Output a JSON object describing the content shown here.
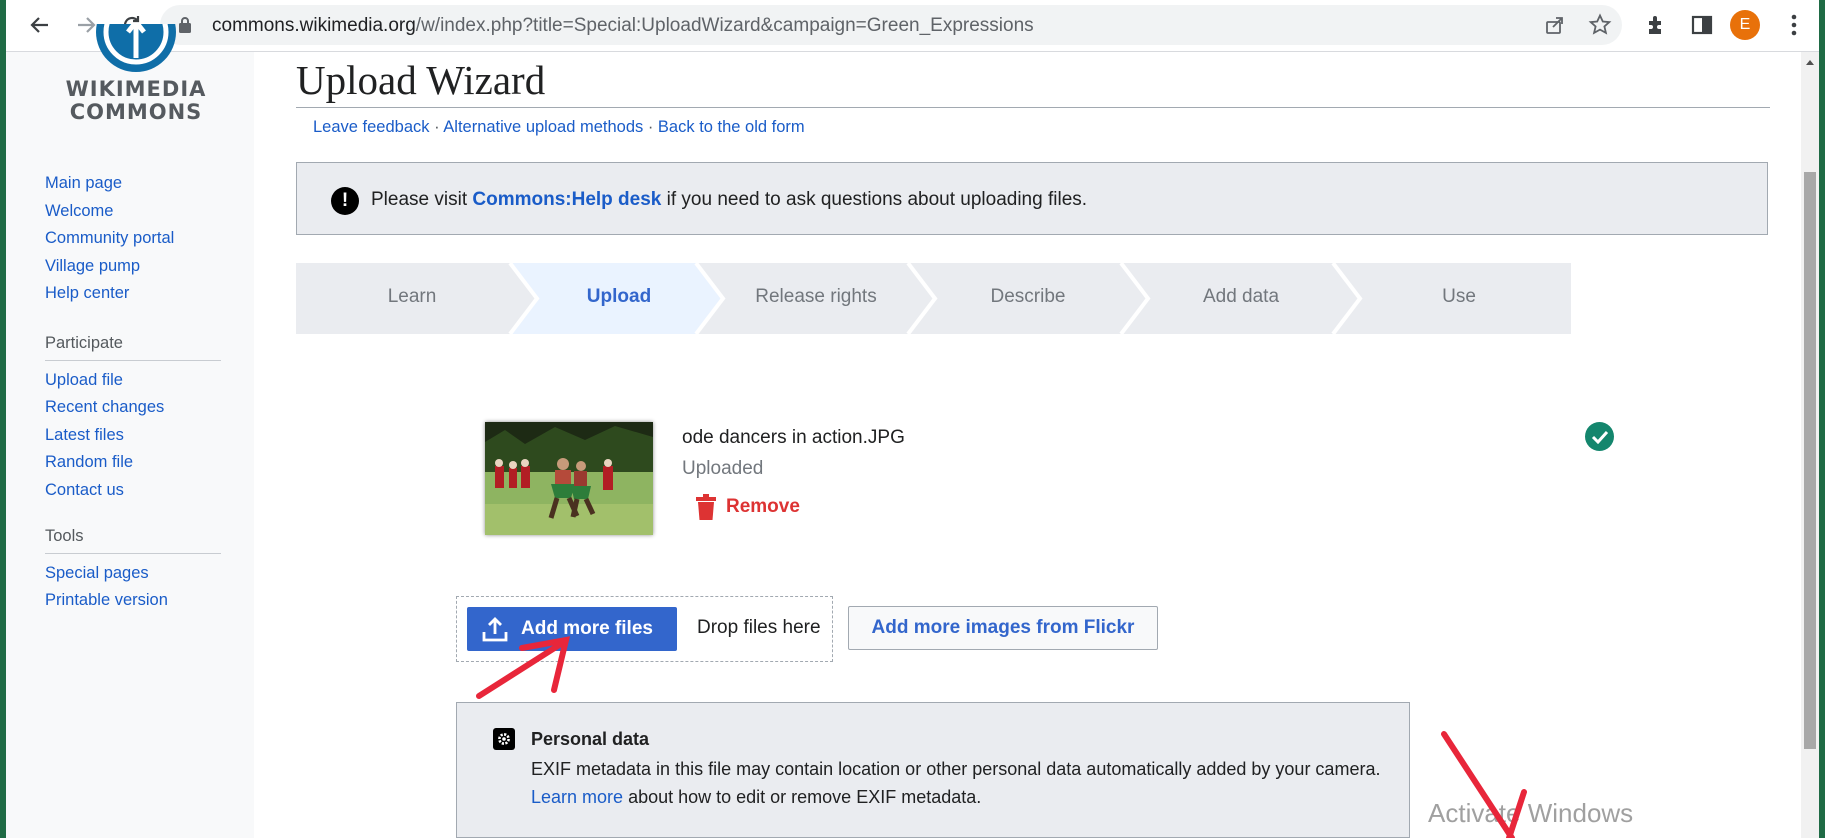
{
  "browser": {
    "url_host": "commons.wikimedia.org",
    "url_path": "/w/index.php?title=Special:UploadWizard&campaign=Green_Expressions",
    "profile_initial": "E",
    "profile_color": "#e8710a"
  },
  "sidebar": {
    "logo_line1": "WIKIMEDIA",
    "logo_line2": "COMMONS",
    "nav_main": [
      "Main page",
      "Welcome",
      "Community portal",
      "Village pump",
      "Help center"
    ],
    "participate_heading": "Participate",
    "nav_participate": [
      "Upload file",
      "Recent changes",
      "Latest files",
      "Random file",
      "Contact us"
    ],
    "tools_heading": "Tools",
    "nav_tools": [
      "Special pages",
      "Printable version"
    ]
  },
  "main": {
    "title": "Upload Wizard",
    "top_links": [
      "Leave feedback",
      "Alternative upload methods",
      "Back to the old form"
    ],
    "link_separator": " · ",
    "notice": {
      "icon": "!",
      "prefix": "Please visit ",
      "link": "Commons:Help desk",
      "suffix": " if you need to ask questions about uploading files."
    },
    "steps": [
      {
        "label": "Learn",
        "active": false
      },
      {
        "label": "Upload",
        "active": true
      },
      {
        "label": "Release rights",
        "active": false
      },
      {
        "label": "Describe",
        "active": false
      },
      {
        "label": "Add data",
        "active": false
      },
      {
        "label": "Use",
        "active": false
      }
    ],
    "file": {
      "name": "ode dancers in action.JPG",
      "status": "Uploaded",
      "remove_label": "Remove"
    },
    "add_more_files_label": "Add more files",
    "drop_files_label": "Drop files here",
    "flickr_label": "Add more images from Flickr",
    "personal_data": {
      "title": "Personal data",
      "text_before": "EXIF metadata in this file may contain location or other personal data automatically added by your camera. ",
      "link": "Learn more",
      "text_after": " about how to edit or remove EXIF metadata."
    },
    "watermark": "Activate Windows"
  },
  "colors": {
    "link": "#1a5cc8",
    "accent": "#3366cc",
    "destructive": "#d33",
    "success": "#14866d",
    "annotation_arrow": "#e8263a"
  }
}
